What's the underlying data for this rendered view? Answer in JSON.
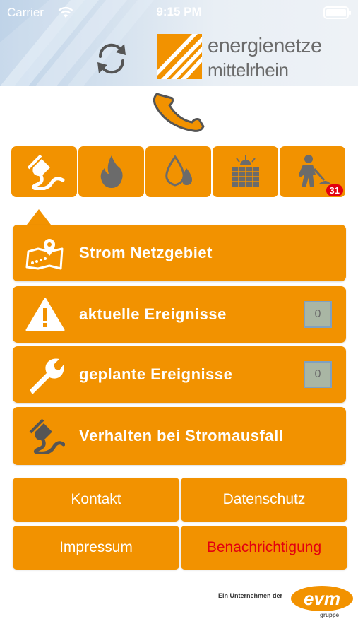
{
  "status_bar": {
    "carrier": "Carrier",
    "time": "9:15 PM"
  },
  "header": {
    "logo_line1": "energienetze",
    "logo_line2": "mittelrhein",
    "refresh_icon": "refresh-icon",
    "phone_icon": "phone-icon"
  },
  "tabs": [
    {
      "icon": "plug-icon",
      "active": true
    },
    {
      "icon": "flame-icon"
    },
    {
      "icon": "water-drops-icon"
    },
    {
      "icon": "solar-panel-icon"
    },
    {
      "icon": "construction-worker-icon",
      "badge": "31"
    }
  ],
  "menu": {
    "items": [
      {
        "label": "Strom Netzgebiet",
        "icon": "map-pin-icon"
      },
      {
        "label": "aktuelle Ereignisse",
        "icon": "warning-icon",
        "count": "0"
      },
      {
        "label": "geplante Ereignisse",
        "icon": "wrench-icon",
        "count": "0"
      },
      {
        "label": "Verhalten bei Stromausfall",
        "icon": "plug-icon"
      }
    ]
  },
  "footer": {
    "buttons": [
      {
        "label": "Kontakt"
      },
      {
        "label": "Datenschutz"
      },
      {
        "label": "Impressum"
      },
      {
        "label": "Benachrichtigung"
      }
    ],
    "company_note": "Ein Unternehmen der",
    "group_logo_text": "evm",
    "group_sub": "gruppe"
  },
  "colors": {
    "accent": "#f29200",
    "alert": "#e3000f",
    "icon_gray": "#6b6b6b",
    "header_blue": "#bfd3e8"
  }
}
